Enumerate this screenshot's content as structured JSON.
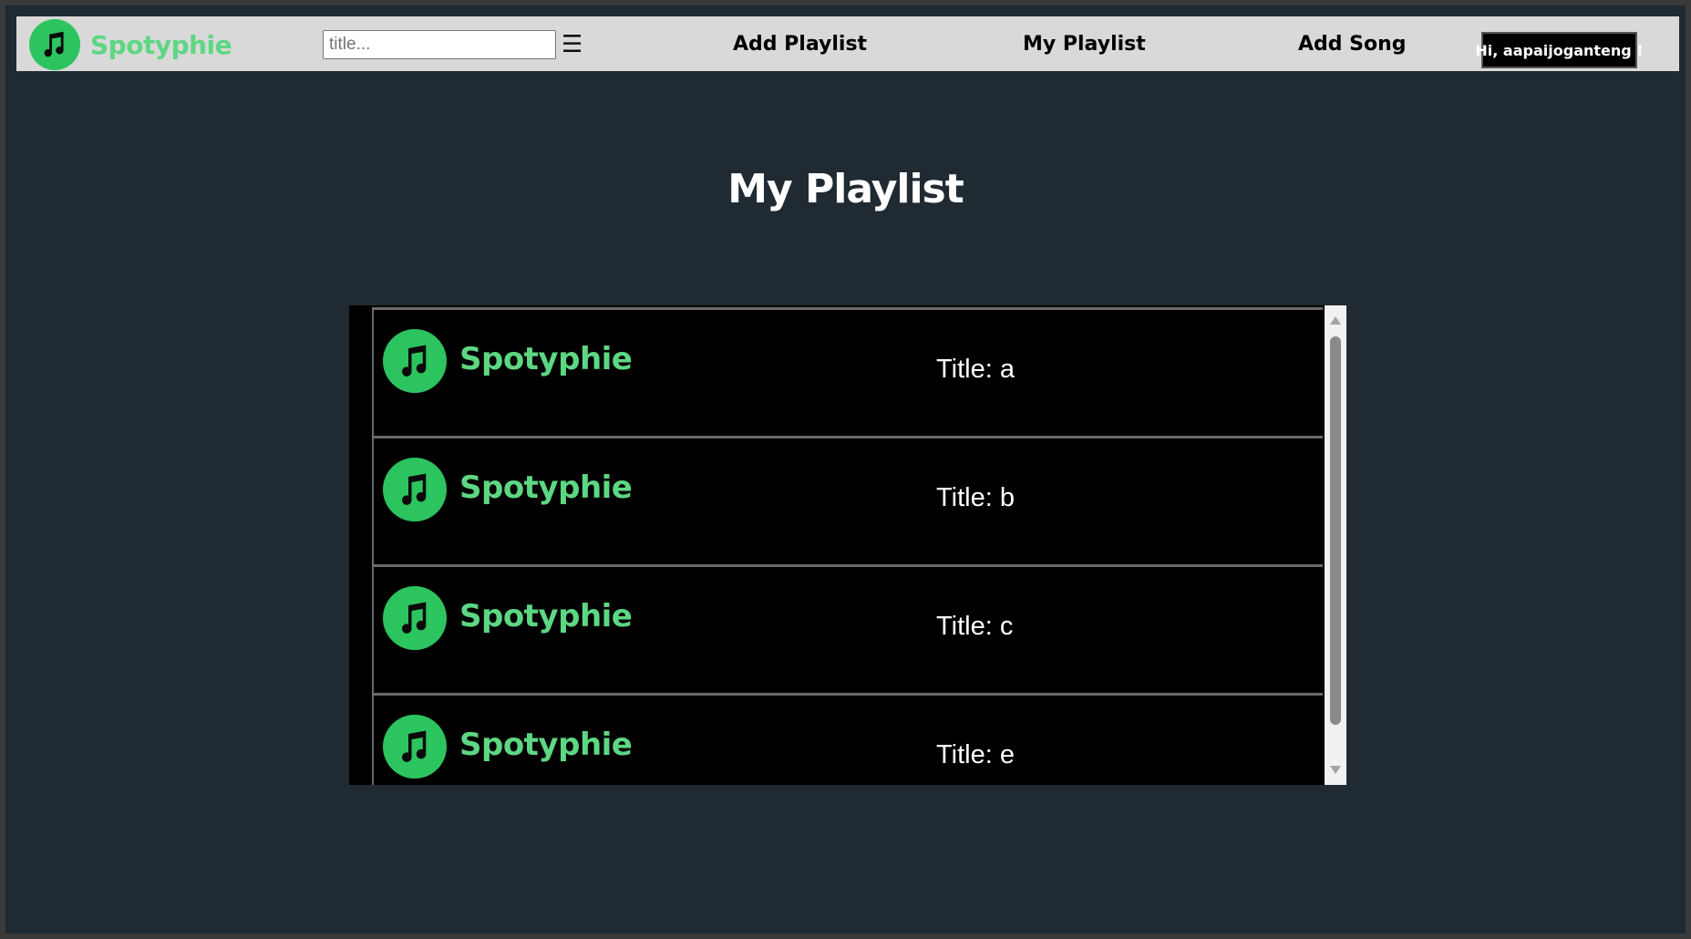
{
  "navbar": {
    "brand": "Spotyphie",
    "search_placeholder": "title...",
    "menu_icon": "☰",
    "links": {
      "add_playlist": "Add Playlist",
      "my_playlist": "My Playlist",
      "add_song": "Add Song"
    },
    "user_greeting": "Hi, aapaijoganteng !"
  },
  "main": {
    "title": "My Playlist"
  },
  "playlist": {
    "items": [
      {
        "brand": "Spotyphie",
        "title": "Title: a"
      },
      {
        "brand": "Spotyphie",
        "title": "Title: b"
      },
      {
        "brand": "Spotyphie",
        "title": "Title: c"
      },
      {
        "brand": "Spotyphie",
        "title": "Title: e"
      }
    ]
  },
  "colors": {
    "page_background": "#202a32",
    "navbar_background": "#d9d9d9",
    "brand_green": "#2cc45f",
    "brand_text_green": "#5dd782",
    "panel_background": "#000000"
  },
  "icons": {
    "logo": "music-note-icon",
    "menu": "hamburger-menu-icon"
  }
}
